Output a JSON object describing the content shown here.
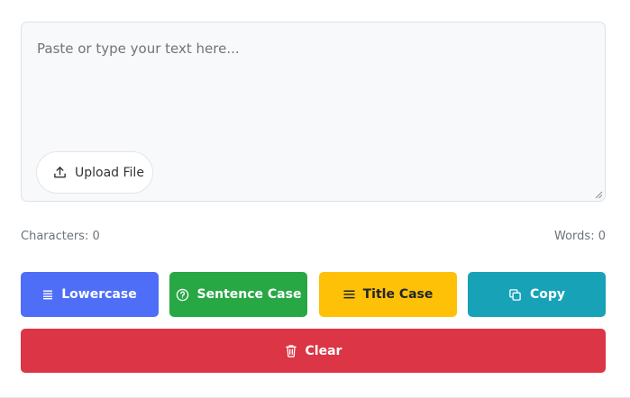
{
  "editor": {
    "placeholder": "Paste or type your text here...",
    "value": ""
  },
  "upload": {
    "label": "Upload File",
    "icon": "upload-icon"
  },
  "stats": {
    "characters": "Characters: 0",
    "words": "Words: 0"
  },
  "buttons": {
    "lowercase": {
      "label": "Lowercase",
      "icon": "list-icon",
      "color": "#4f6ef7"
    },
    "sentence": {
      "label": "Sentence Case",
      "icon": "question-circle-icon",
      "color": "#28a745"
    },
    "title": {
      "label": "Title Case",
      "icon": "menu-icon",
      "color": "#ffc107"
    },
    "copy": {
      "label": "Copy",
      "icon": "copy-icon",
      "color": "#17a2b8"
    },
    "clear": {
      "label": "Clear",
      "icon": "trash-icon",
      "color": "#dc3545"
    }
  }
}
